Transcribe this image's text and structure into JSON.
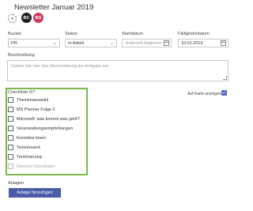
{
  "card": {
    "title": "Newsletter Januar 2019",
    "add_member_symbol": "+",
    "members": [
      {
        "initials": "BC",
        "color": "#1f1f1f"
      },
      {
        "initials": "BS",
        "color": "#d13a5c"
      }
    ]
  },
  "fields": {
    "bucket": {
      "label": "Bucket",
      "value": "PR"
    },
    "status": {
      "label": "Status",
      "value": "In Arbeit"
    },
    "start": {
      "label": "Startdatum",
      "placeholder": "Jederzeit beginnen"
    },
    "due": {
      "label": "Fälligkeitsdatum",
      "value": "10.01.2019"
    }
  },
  "description": {
    "label": "Beschreibung",
    "placeholder": "Geben Sie hier Ihre Beschreibung der Aufgabe ein."
  },
  "checklist": {
    "label": "Checkliste 0/7",
    "items": [
      "Themenauswahl",
      "MS Planner Folge 2",
      "Microsoft: was kommt was geht?",
      "Veranstaltungsempfehlungen",
      "Korrektur lesen",
      "Textversand",
      "Terminierung"
    ],
    "add_placeholder": "Element hinzufügen",
    "show_on_card_label": "Auf Karte anzeigen",
    "show_on_card_checked": true,
    "checkmark": "✓"
  },
  "attachments": {
    "label": "Anlagen",
    "button_label": "Anlage hinzufügen"
  },
  "colors": {
    "highlight": "#7cb94a",
    "accent": "#4a5ba8"
  }
}
